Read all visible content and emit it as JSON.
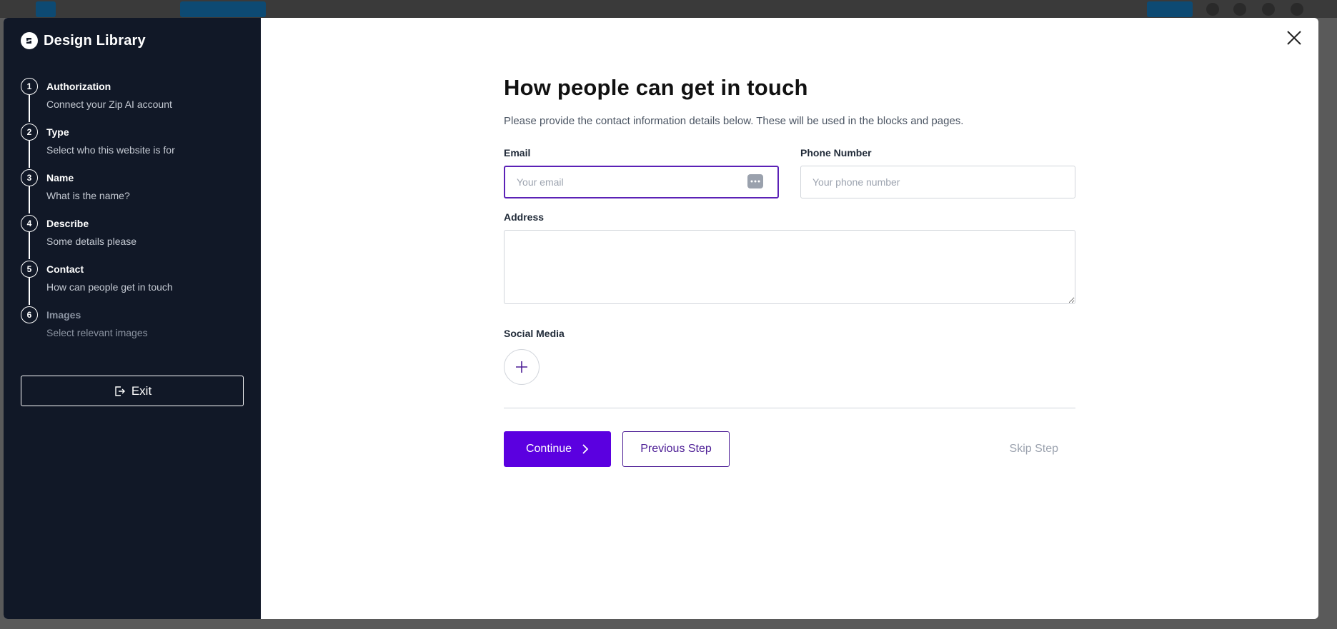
{
  "brand": {
    "name": "Design Library",
    "logo_icon": "brand-logo-icon"
  },
  "steps": [
    {
      "number": "1",
      "title": "Authorization",
      "subtitle": "Connect your Zip AI account",
      "state": "done"
    },
    {
      "number": "2",
      "title": "Type",
      "subtitle": "Select who this website is for",
      "state": "done"
    },
    {
      "number": "3",
      "title": "Name",
      "subtitle": "What is the name?",
      "state": "done"
    },
    {
      "number": "4",
      "title": "Describe",
      "subtitle": "Some details please",
      "state": "done"
    },
    {
      "number": "5",
      "title": "Contact",
      "subtitle": "How can people get in touch",
      "state": "current"
    },
    {
      "number": "6",
      "title": "Images",
      "subtitle": "Select relevant images",
      "state": "upcoming"
    }
  ],
  "sidebar": {
    "exit_label": "Exit"
  },
  "form": {
    "heading": "How people can get in touch",
    "description": "Please provide the contact information details below. These will be used in the blocks and pages.",
    "email": {
      "label": "Email",
      "placeholder": "Your email",
      "value": ""
    },
    "phone": {
      "label": "Phone Number",
      "placeholder": "Your phone number",
      "value": ""
    },
    "address": {
      "label": "Address",
      "value": ""
    },
    "social": {
      "label": "Social Media"
    }
  },
  "actions": {
    "continue_label": "Continue",
    "previous_label": "Previous Step",
    "skip_label": "Skip Step"
  },
  "colors": {
    "sidebar_bg": "#111827",
    "accent": "#5b00e0",
    "secondary_border": "#4c1d95"
  }
}
